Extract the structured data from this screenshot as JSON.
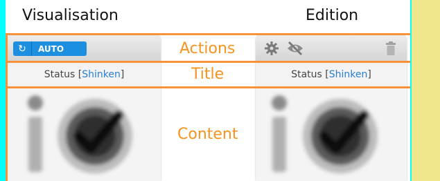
{
  "columns": {
    "visualisation": "Visualisation",
    "edition": "Edition"
  },
  "labels": {
    "actions": "Actions",
    "title": "Title",
    "content": "Content"
  },
  "left_widget": {
    "auto_label": "AUTO",
    "status_text": "Status ",
    "status_open": "[",
    "status_link": "Shinken",
    "status_close": "]"
  },
  "right_widget": {
    "status_text": "Status ",
    "status_open": "[",
    "status_link": "Shinken",
    "status_close": "]"
  },
  "colors": {
    "annotation": "#f7923a",
    "background": "#00ffff",
    "side_panel": "#f0e68c",
    "accent": "#1c8fe0"
  }
}
